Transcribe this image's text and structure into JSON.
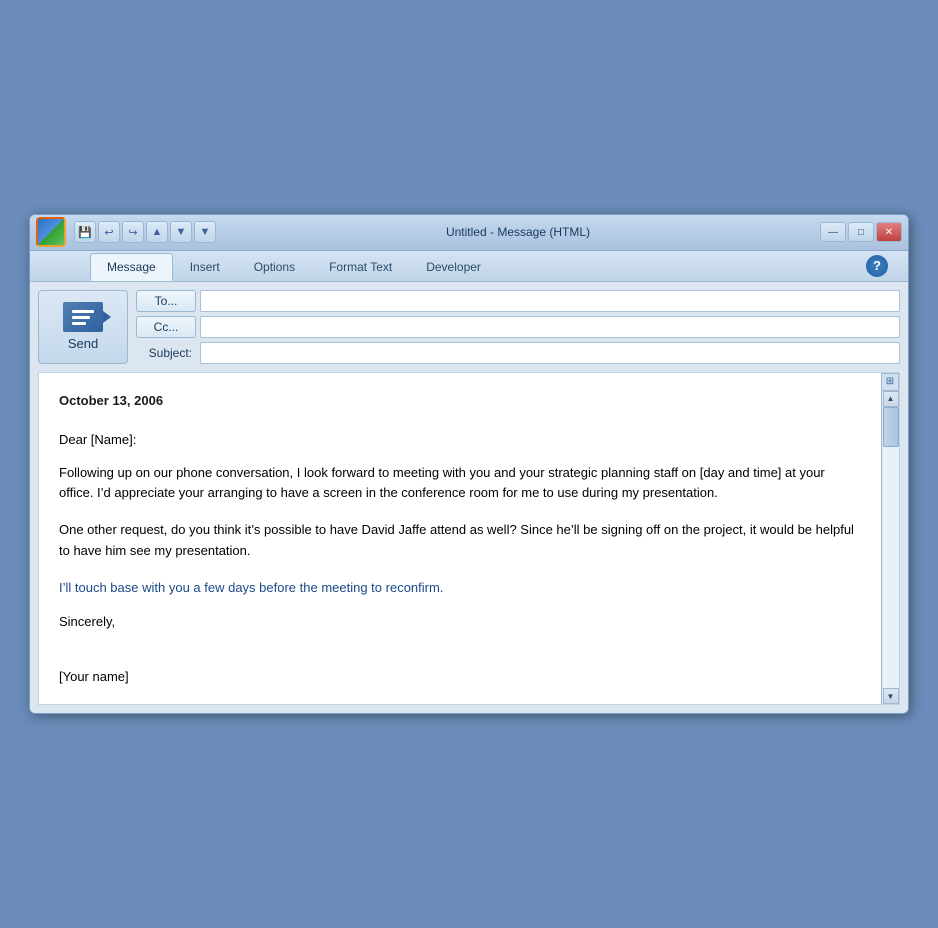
{
  "window": {
    "title": "Untitled - Message (HTML)",
    "logo_label": "O",
    "minimize_label": "—",
    "maximize_label": "□",
    "close_label": "✕"
  },
  "quickaccess": {
    "save_label": "💾",
    "undo_label": "↩",
    "redo_label": "↪",
    "up_label": "▲",
    "down_label": "▼",
    "dropdown_label": "▼"
  },
  "tabs": {
    "items": [
      {
        "id": "message",
        "label": "Message",
        "active": true
      },
      {
        "id": "insert",
        "label": "Insert",
        "active": false
      },
      {
        "id": "options",
        "label": "Options",
        "active": false
      },
      {
        "id": "format_text",
        "label": "Format Text",
        "active": false
      },
      {
        "id": "developer",
        "label": "Developer",
        "active": false
      }
    ],
    "help_label": "?"
  },
  "compose": {
    "to_label": "To...",
    "cc_label": "Cc...",
    "subject_label": "Subject:",
    "to_value": "",
    "cc_value": "",
    "subject_value": "",
    "send_label": "Send"
  },
  "body": {
    "date": "October 13, 2006",
    "salutation": "Dear [Name]:",
    "paragraph1": "Following up on our phone conversation, I look forward to meeting with you and your strategic planning staff on [day and time] at your office. I’d appreciate your arranging to have a screen in the conference room for me to use during my presentation.",
    "paragraph2": "One other request, do you think it’s possible to have David Jaffe attend as well? Since he’ll be signing off on the project, it would be helpful to have him see my presentation.",
    "paragraph3": "I’ll touch base with you a few days before the meeting to reconfirm.",
    "closing": "Sincerely,",
    "signature": "[Your name]"
  }
}
